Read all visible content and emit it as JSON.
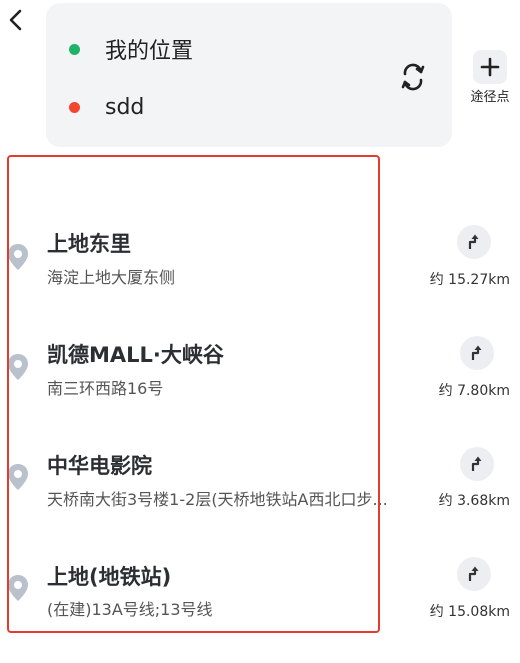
{
  "route": {
    "start_text": "我的位置",
    "end_text": "sdd"
  },
  "waypoint": {
    "label": "途径点"
  },
  "results": [
    {
      "name": "上地东里",
      "address": "海淀上地大厦东侧",
      "distance": "约 15.27km"
    },
    {
      "name": "凯德MALL·大峡谷",
      "address": "南三环西路16号",
      "distance": "约 7.80km"
    },
    {
      "name": "中华电影院",
      "address": "天桥南大街3号楼1-2层(天桥地铁站A西北口步...",
      "distance": "约 3.68km"
    },
    {
      "name": "上地(地铁站)",
      "address": "(在建)13A号线;13号线",
      "distance": "约 15.08km"
    }
  ],
  "colors": {
    "start_dot": "#1fb36a",
    "end_dot": "#f2462f",
    "highlight_border": "#e53a2e",
    "pin": "#b9c1cc"
  },
  "icons": {
    "back": "back-arrow-icon",
    "swap": "swap-icon",
    "add": "plus-icon",
    "pin": "location-pin-icon",
    "navigate": "turn-right-icon"
  }
}
